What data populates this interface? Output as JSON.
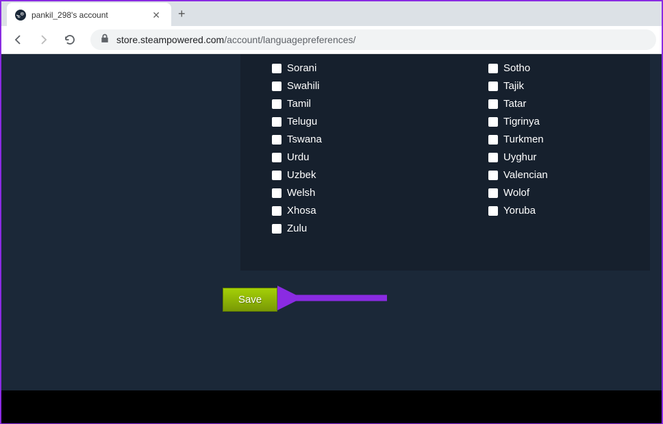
{
  "browser": {
    "tab_title": "pankil_298's account",
    "url_domain": "store.steampowered.com",
    "url_path": "/account/languagepreferences/"
  },
  "languages": {
    "left_column": [
      "Sorani",
      "Swahili",
      "Tamil",
      "Telugu",
      "Tswana",
      "Urdu",
      "Uzbek",
      "Welsh",
      "Xhosa",
      "Zulu"
    ],
    "right_column": [
      "Sotho",
      "Tajik",
      "Tatar",
      "Tigrinya",
      "Turkmen",
      "Uyghur",
      "Valencian",
      "Wolof",
      "Yoruba"
    ]
  },
  "actions": {
    "save_label": "Save"
  },
  "annotation": {
    "arrow_color": "#8a2be2"
  }
}
